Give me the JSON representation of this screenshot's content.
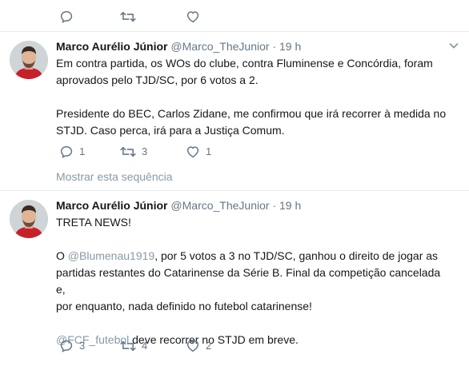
{
  "previous_tweet": {
    "actions": {
      "reply_count": "",
      "retweet_count": "",
      "like_count": ""
    }
  },
  "tweets": [
    {
      "author": {
        "fullname": "Marco Aurélio Júnior",
        "username": "@Marco_TheJunior"
      },
      "dot": "·",
      "time": "19 h",
      "lines": [
        "Em contra partida, os WOs do clube, contra Fluminense e Concórdia, foram",
        "aprovados pelo TJD/SC, por 6 votos a 2.",
        "Presidente do BEC, Carlos Zidane, me confirmou que irá recorrer à medida no",
        "STJD. Caso perca, irá para a Justiça Comum."
      ],
      "actions": {
        "reply_count": "1",
        "retweet_count": "3",
        "like_count": "1"
      },
      "thread_link": "Mostrar esta sequência"
    },
    {
      "author": {
        "fullname": "Marco Aurélio Júnior",
        "username": "@Marco_TheJunior"
      },
      "dot": "·",
      "time": "19 h",
      "headline": "TRETA NEWS!",
      "para1": {
        "prefix": "O ",
        "mention": "@Blumenau1919",
        "rest": ", por 5 votos a 3 no TJD/SC, ganhou o direito de jogar as",
        "line2": "partidas restantes do Catarinense da Série B. Final da competição cancelada e,",
        "line3": "por enquanto, nada definido no futebol catarinense!"
      },
      "para2": {
        "mention": "@FCF_futebol",
        "rest": " deve recorrer no STJD em breve."
      },
      "actions": {
        "reply_count": "3",
        "retweet_count": "4",
        "like_count": "2"
      }
    }
  ],
  "icons": {
    "reply": "reply-icon",
    "retweet": "retweet-icon",
    "like": "heart-icon",
    "caret": "chevron-down-icon"
  },
  "colors": {
    "text": "#14171a",
    "secondary": "#657786",
    "link_muted": "#8899a6",
    "border": "#e6ecf0"
  }
}
